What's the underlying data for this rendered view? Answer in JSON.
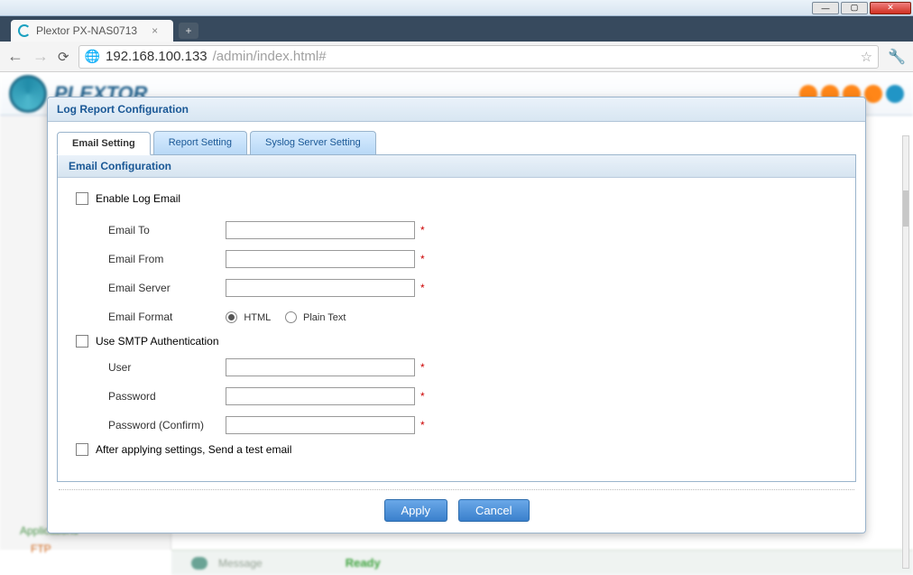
{
  "window": {
    "title": "Plextor PX-NAS0713"
  },
  "browser": {
    "tab_title": "Plextor PX-NAS0713",
    "url_host": "192.168.100.133",
    "url_path": "/admin/index.html#"
  },
  "background": {
    "brand": "PLEXTOR",
    "sidebar": {
      "applications": "Applications",
      "ftp": "FTP"
    },
    "status": {
      "message_label": "Message",
      "ready": "Ready"
    }
  },
  "modal": {
    "title": "Log Report Configuration",
    "tabs": {
      "email": "Email Setting",
      "report": "Report Setting",
      "syslog": "Syslog Server Setting"
    },
    "section_header": "Email Configuration",
    "enable_label": "Enable Log Email",
    "fields": {
      "email_to": {
        "label": "Email To",
        "value": ""
      },
      "email_from": {
        "label": "Email From",
        "value": ""
      },
      "email_server": {
        "label": "Email Server",
        "value": ""
      },
      "email_format": {
        "label": "Email Format",
        "html": "HTML",
        "plain": "Plain Text",
        "selected": "html"
      },
      "smtp_auth": "Use SMTP Authentication",
      "user": {
        "label": "User",
        "value": ""
      },
      "password": {
        "label": "Password",
        "value": ""
      },
      "password_confirm": {
        "label": "Password (Confirm)",
        "value": ""
      },
      "send_test": "After applying settings, Send a test email"
    },
    "buttons": {
      "apply": "Apply",
      "cancel": "Cancel"
    },
    "required_mark": "*"
  }
}
